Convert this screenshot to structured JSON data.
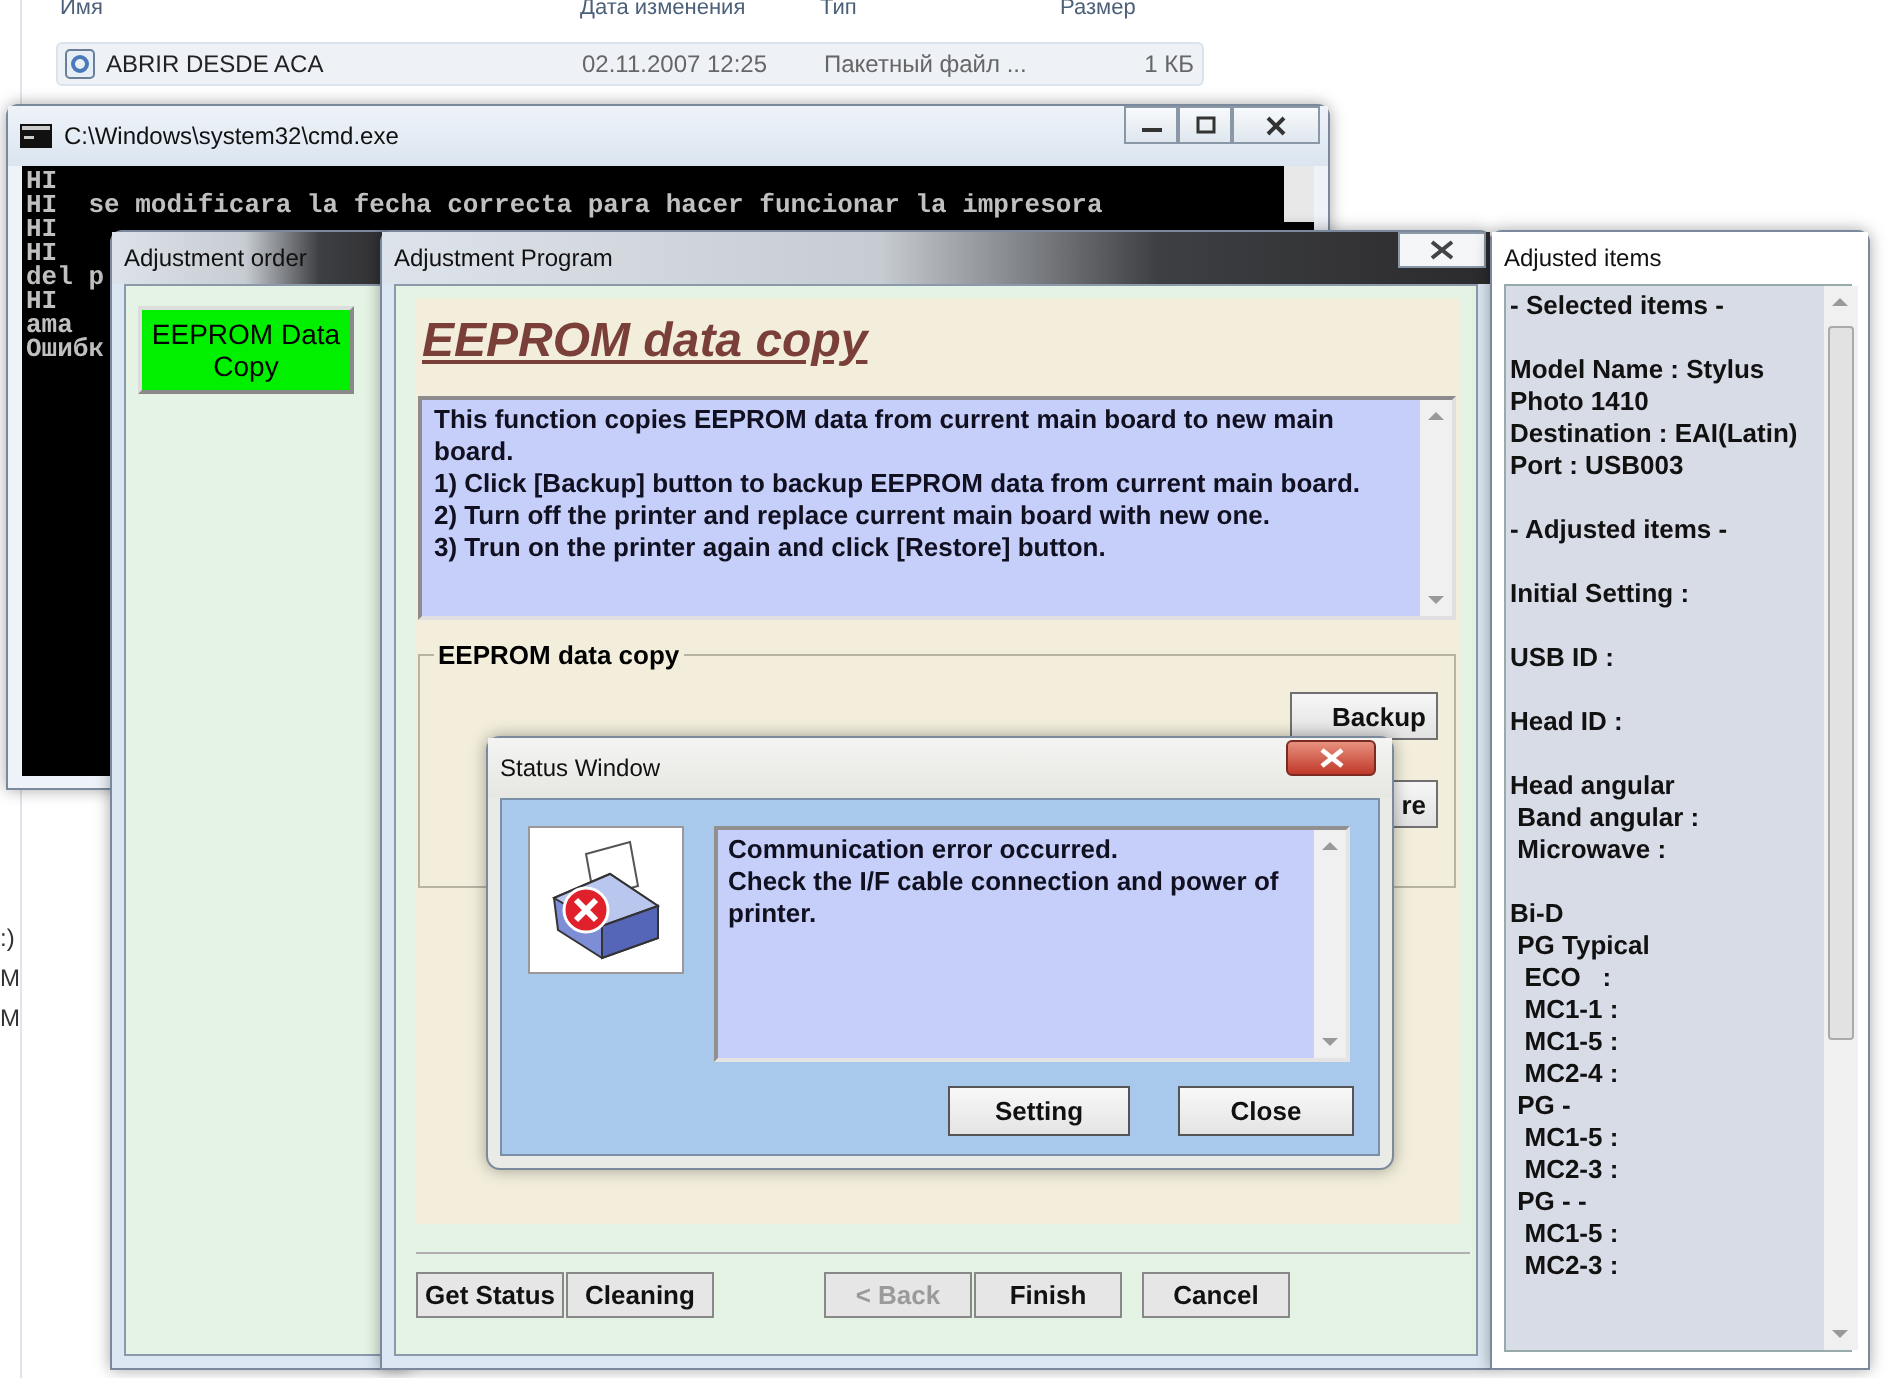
{
  "explorer": {
    "columns": [
      "Имя",
      "Дата изменения",
      "Тип",
      "Размер"
    ],
    "rows": [
      {
        "name": "ABRIR DESDE ACA",
        "date": "02.11.2007 12:25",
        "type": "Пакетный файл ...",
        "size": "1 КБ",
        "selected": true
      }
    ],
    "side_texts": [
      ":)",
      "M",
      "M"
    ]
  },
  "cmd": {
    "title": "C:\\Windows\\system32\\cmd.exe",
    "lines": [
      "HI",
      "HI  se modificara la fecha correcta para hacer funcionar la impresora",
      "HI",
      "HI",
      "del p",
      "HI",
      "ama",
      "Ошибк"
    ]
  },
  "adjustment_order": {
    "title": "Adjustment order",
    "items": [
      {
        "label": "EEPROM Data Copy",
        "selected": true
      }
    ]
  },
  "adjustment_program": {
    "title": "Adjustment Program",
    "heading": "EEPROM data copy",
    "description": [
      "This function copies EEPROM data from current main board to new main board.",
      "1) Click [Backup] button to backup EEPROM data from current main board.",
      "2) Turn off the printer and replace current main board with new one.",
      "3) Trun on the printer again and click [Restore] button."
    ],
    "group": {
      "label": "EEPROM data copy",
      "buttons": [
        "Backup",
        "re"
      ]
    },
    "buttons": [
      {
        "label": "Get Status",
        "disabled": false
      },
      {
        "label": "Cleaning",
        "disabled": false
      },
      {
        "label": "< Back",
        "disabled": true
      },
      {
        "label": "Finish",
        "disabled": false
      },
      {
        "label": "Cancel",
        "disabled": false
      }
    ]
  },
  "adjusted_items": {
    "title": "Adjusted items",
    "blocks": [
      [
        "- Selected items -"
      ],
      [
        "Model Name : Stylus Photo 1410",
        "Destination : EAI(Latin)",
        "Port : USB003"
      ],
      [
        "- Adjusted items -"
      ],
      [
        "Initial Setting :"
      ],
      [
        "USB ID :"
      ],
      [
        "Head ID :"
      ],
      [
        "Head angular",
        " Band angular :",
        " Microwave :"
      ],
      [
        "Bi-D",
        " PG Typical",
        "  ECO   :",
        "  MC1-1 :",
        "  MC1-5 :",
        "  MC2-4 :",
        " PG -",
        "  MC1-5 :",
        "  MC2-3 :",
        " PG - -",
        "  MC1-5 :",
        "  MC2-3 :"
      ]
    ]
  },
  "status_window": {
    "title": "Status Window",
    "message": "Communication error occurred.\nCheck the I/F cable connection and power of printer.",
    "buttons": [
      "Setting",
      "Close"
    ]
  }
}
